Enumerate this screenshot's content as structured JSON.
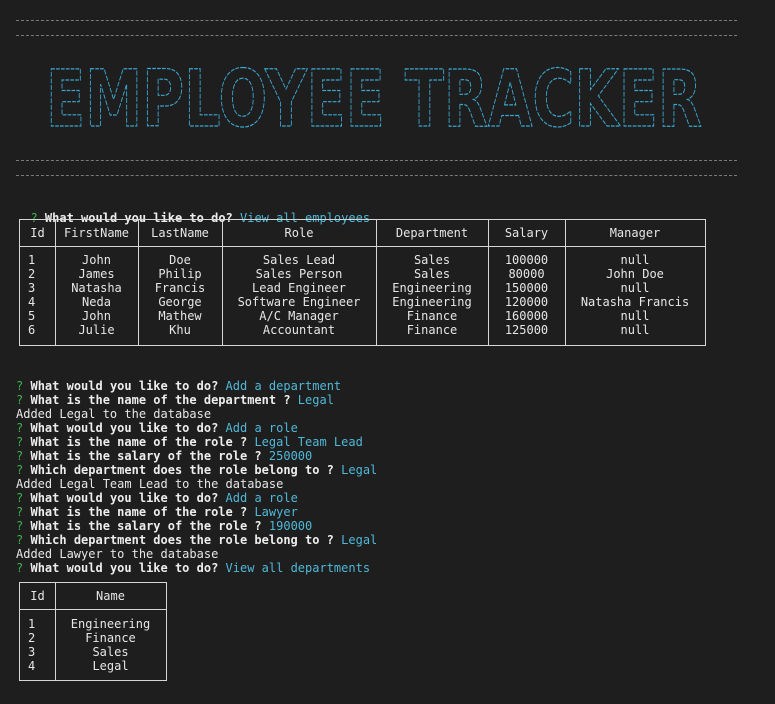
{
  "banner": {
    "title": "EMPLOYEE TRACKER"
  },
  "employees_prompt": {
    "mark": "?",
    "question": "What would you like to do?",
    "answer": "View all employees"
  },
  "employees_table": {
    "columns": [
      "Id",
      "FirstName",
      "LastName",
      "Role",
      "Department",
      "Salary",
      "Manager"
    ],
    "rows": [
      [
        "1",
        "John",
        "Doe",
        "Sales Lead",
        "Sales",
        "100000",
        "null"
      ],
      [
        "2",
        "James",
        "Philip",
        "Sales Person",
        "Sales",
        "80000",
        "John Doe"
      ],
      [
        "3",
        "Natasha",
        "Francis",
        "Lead Engineer",
        "Engineering",
        "150000",
        "null"
      ],
      [
        "4",
        "Neda",
        "George",
        "Software Engineer",
        "Engineering",
        "120000",
        "Natasha Francis"
      ],
      [
        "5",
        "John",
        "Mathew",
        "A/C Manager",
        "Finance",
        "160000",
        "null"
      ],
      [
        "6",
        "Julie",
        "Khu",
        "Accountant",
        "Finance",
        "125000",
        "null"
      ]
    ]
  },
  "transcript": [
    {
      "type": "prompt",
      "mark": "?",
      "question": "What would you like to do?",
      "answer": "Add a department"
    },
    {
      "type": "prompt",
      "mark": "?",
      "question": "What is the name of the department ?",
      "answer": "Legal"
    },
    {
      "type": "output",
      "text": "Added Legal to the database"
    },
    {
      "type": "prompt",
      "mark": "?",
      "question": "What would you like to do?",
      "answer": "Add a role"
    },
    {
      "type": "prompt",
      "mark": "?",
      "question": "What is the name of the role ?",
      "answer": "Legal Team Lead"
    },
    {
      "type": "prompt",
      "mark": "?",
      "question": "What is the salary of the role ?",
      "answer": "250000"
    },
    {
      "type": "prompt",
      "mark": "?",
      "question": "Which department does the role belong to ?",
      "answer": "Legal"
    },
    {
      "type": "output",
      "text": "Added Legal Team Lead to the database"
    },
    {
      "type": "prompt",
      "mark": "?",
      "question": "What would you like to do?",
      "answer": "Add a role"
    },
    {
      "type": "prompt",
      "mark": "?",
      "question": "What is the name of the role ?",
      "answer": "Lawyer"
    },
    {
      "type": "prompt",
      "mark": "?",
      "question": "What is the salary of the role ?",
      "answer": "190000"
    },
    {
      "type": "prompt",
      "mark": "?",
      "question": "Which department does the role belong to ?",
      "answer": "Legal"
    },
    {
      "type": "output",
      "text": "Added Lawyer to the database"
    },
    {
      "type": "prompt",
      "mark": "?",
      "question": "What would you like to do?",
      "answer": "View all departments"
    }
  ],
  "departments_table": {
    "columns": [
      "Id",
      "Name"
    ],
    "rows": [
      [
        "1",
        "Engineering"
      ],
      [
        "2",
        "Finance"
      ],
      [
        "3",
        "Sales"
      ],
      [
        "4",
        "Legal"
      ]
    ]
  },
  "colors": {
    "background": "#1e1e1e",
    "text": "#e6e6e6",
    "prompt_mark": "#3bb34a",
    "answer": "#4fb8d8",
    "banner": "#3aa6cf",
    "rule": "#7a7a7a",
    "table_border": "#d6d6d6"
  }
}
